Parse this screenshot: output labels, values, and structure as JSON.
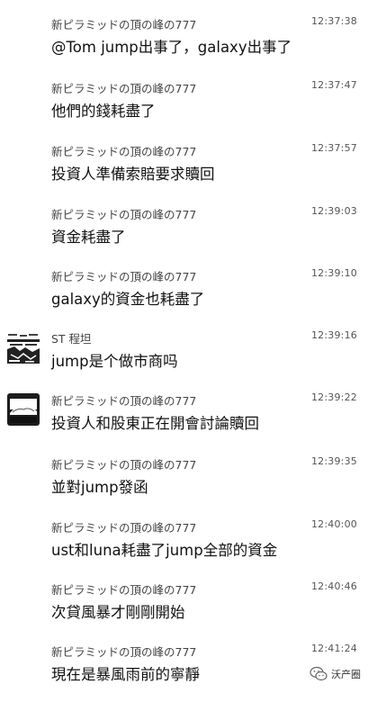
{
  "messages": [
    {
      "sender": "新ピラミッドの頂の峰の777",
      "time": "12:37:38",
      "text": "@Tom jump出事了，galaxy出事了",
      "avatar": "none"
    },
    {
      "sender": "新ピラミッドの頂の峰の777",
      "time": "12:37:47",
      "text": "他們的錢耗盡了",
      "avatar": "none"
    },
    {
      "sender": "新ピラミッドの頂の峰の777",
      "time": "12:37:57",
      "text": "投資人準備索賠要求贖回",
      "avatar": "none"
    },
    {
      "sender": "新ピラミッドの頂の峰の777",
      "time": "12:39:03",
      "text": "資金耗盡了",
      "avatar": "none"
    },
    {
      "sender": "新ピラミッドの頂の峰の777",
      "time": "12:39:10",
      "text": "galaxy的資金也耗盡了",
      "avatar": "none"
    },
    {
      "sender": "ST 程坦",
      "time": "12:39:16",
      "text": "jump是个做市商吗",
      "avatar": "st-avatar-icon"
    },
    {
      "sender": "新ピラミッドの頂の峰の777",
      "time": "12:39:22",
      "text": "投資人和股東正在開會討論贖回",
      "avatar": "mountain-avatar-icon"
    },
    {
      "sender": "新ピラミッドの頂の峰の777",
      "time": "12:39:35",
      "text": "並對jump發函",
      "avatar": "none"
    },
    {
      "sender": "新ピラミッドの頂の峰の777",
      "time": "12:40:00",
      "text": "ust和luna耗盡了jump全部的資金",
      "avatar": "none"
    },
    {
      "sender": "新ピラミッドの頂の峰の777",
      "time": "12:40:46",
      "text": "次貸風暴才剛剛開始",
      "avatar": "none"
    },
    {
      "sender": "新ピラミッドの頂の峰の777",
      "time": "12:41:24",
      "text": "現在是暴風雨前的寧靜",
      "avatar": "none"
    }
  ],
  "watermark": {
    "text": "沃产圈",
    "icon": "wechat-logo-icon"
  }
}
